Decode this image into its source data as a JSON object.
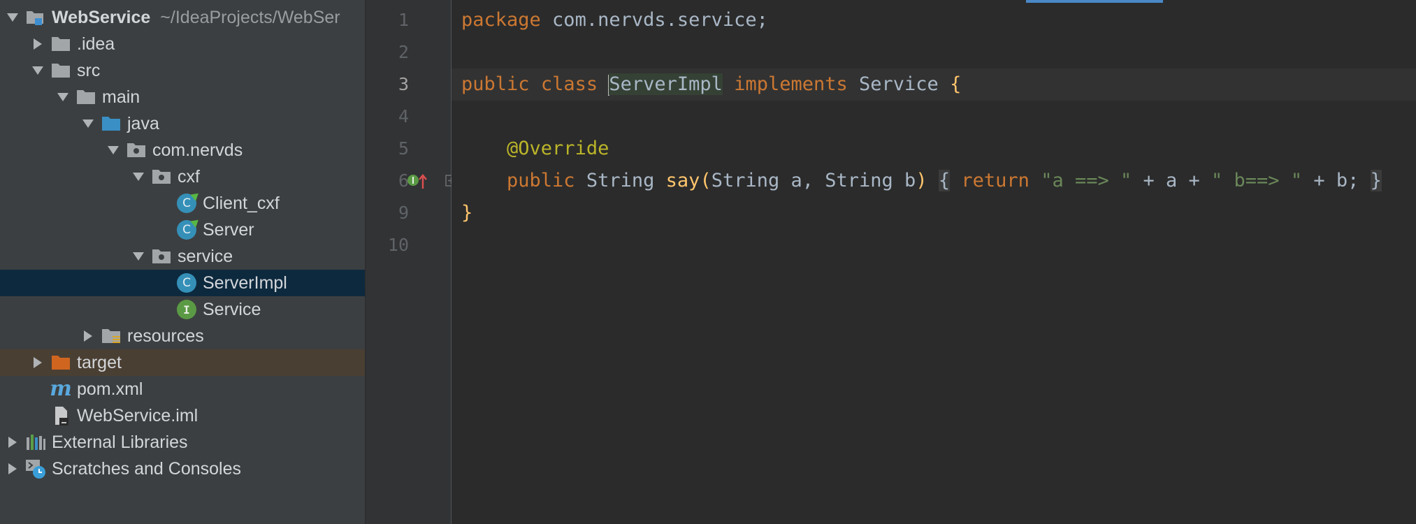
{
  "tree": {
    "items": [
      {
        "label": "WebService",
        "path": "~/IdeaProjects/WebSer",
        "icon": "module-folder-icon"
      },
      {
        "label": ".idea",
        "icon": "folder-icon"
      },
      {
        "label": "src",
        "icon": "folder-icon"
      },
      {
        "label": "main",
        "icon": "folder-icon"
      },
      {
        "label": "java",
        "icon": "source-folder-icon"
      },
      {
        "label": "com.nervds",
        "icon": "package-icon"
      },
      {
        "label": "cxf",
        "icon": "package-icon"
      },
      {
        "label": "Client_cxf",
        "icon": "runnable-class-icon"
      },
      {
        "label": "Server",
        "icon": "runnable-class-icon"
      },
      {
        "label": "service",
        "icon": "package-icon"
      },
      {
        "label": "ServerImpl",
        "icon": "class-icon"
      },
      {
        "label": "Service",
        "icon": "interface-icon"
      },
      {
        "label": "resources",
        "icon": "resources-folder-icon"
      },
      {
        "label": "target",
        "icon": "excluded-folder-icon"
      },
      {
        "label": "pom.xml",
        "icon": "maven-icon"
      },
      {
        "label": "WebService.iml",
        "icon": "iml-file-icon"
      },
      {
        "label": "External Libraries",
        "icon": "libraries-icon"
      },
      {
        "label": "Scratches and Consoles",
        "icon": "scratches-icon"
      }
    ],
    "class_icon_letter": "C",
    "interface_icon_letter": "I"
  },
  "gutter": {
    "line_numbers": [
      "1",
      "2",
      "3",
      "4",
      "5",
      "6",
      "9",
      "10"
    ]
  },
  "code": {
    "l1": {
      "kw": "package",
      "rest": " com.nervds.service;"
    },
    "l3": {
      "kw1": "public",
      "kw2": "class",
      "ident": "ServerImpl",
      "kw3": "implements",
      "type": "Service",
      "brace": "{"
    },
    "l5": {
      "annotation": "@Override"
    },
    "l6": {
      "kw": "public",
      "ret_type": "String",
      "method": "say",
      "paren_open": "(",
      "params": "String a, String b",
      "paren_close": ")",
      "fold_open": "{",
      "return_kw": "return",
      "str1": "\"a ==> \"",
      "mid1": " + a + ",
      "str2": "\" b==> \"",
      "mid2": " + b;",
      "fold_close": "}"
    },
    "l9": {
      "brace": "}"
    }
  },
  "colors": {
    "keyword": "#cc7832",
    "string": "#6a8759",
    "annotation": "#bbb529",
    "method": "#ffc66d",
    "text": "#a9b7c6",
    "selection": "#0d293e"
  }
}
